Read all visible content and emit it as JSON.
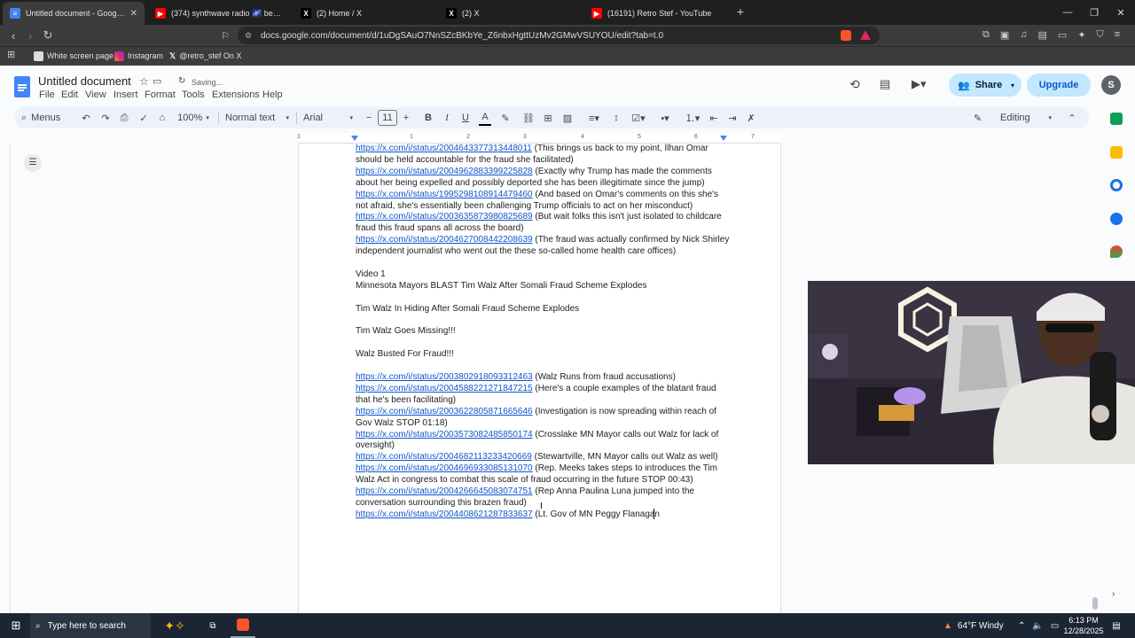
{
  "browser": {
    "tabs": [
      {
        "title": "Untitled document - Google Docs",
        "icon": "docs-icon",
        "active": true
      },
      {
        "title": "(374) synthwave radio 🌌 beats t",
        "icon": "youtube-icon",
        "active": false
      },
      {
        "title": "(2) Home / X",
        "icon": "x-icon",
        "active": false
      },
      {
        "title": "(2) X",
        "icon": "x-icon",
        "active": false
      },
      {
        "title": "(16191) Retro Stef - YouTube",
        "icon": "youtube-icon",
        "active": false
      }
    ],
    "url": "docs.google.com/document/d/1uDgSAuO7NnSZcBKbYe_Z6nbxHgttUzMv2GMwVSUYOU/edit?tab=t.0",
    "bookmarks": [
      "White screen page",
      "Instagram",
      "@retro_stef On X"
    ]
  },
  "docs": {
    "title": "Untitled document",
    "saving_status": "Saving...",
    "menu": [
      "File",
      "Edit",
      "View",
      "Insert",
      "Format",
      "Tools",
      "Extensions",
      "Help"
    ],
    "share_label": "Share",
    "upgrade_label": "Upgrade",
    "avatar_letter": "S",
    "toolbar": {
      "search": "Menus",
      "zoom": "100%",
      "style": "Normal text",
      "font": "Arial",
      "font_size": "11",
      "mode": "Editing",
      "bold": "B",
      "italic": "I",
      "underline": "U",
      "text_color": "A"
    },
    "ruler_marks": [
      "1",
      "1",
      "2",
      "3",
      "4",
      "5",
      "6",
      "7"
    ]
  },
  "document": {
    "lines": [
      {
        "link": "https://x.com/i/status/2004643377313448011",
        "text": " (This brings us back to my point, Ilhan Omar"
      },
      {
        "link": "",
        "text": "should be held accountable for the fraud she facilitated)"
      },
      {
        "link": "https://x.com/i/status/2004962883399225828",
        "text": " (Exactly why Trump has made the comments"
      },
      {
        "link": "",
        "text": "about her being expelled and possibly deported she has been illegitimate since the jump)"
      },
      {
        "link": "https://x.com/i/status/1995298108914479460",
        "text": " (And based on Omar's comments on this she's"
      },
      {
        "link": "",
        "text": "not afraid, she's essentially been challenging Trump officials to act on her misconduct)"
      },
      {
        "link": "https://x.com/i/status/2003635873980825689",
        "text": " (But wait folks this isn't just isolated to childcare"
      },
      {
        "link": "",
        "text": "fraud this fraud spans all across the board)"
      },
      {
        "link": "https://x.com/i/status/2004627008442208639",
        "text": " (The fraud was actually confirmed by Nick Shirley"
      },
      {
        "link": "",
        "text": "independent journalist who went out the these so-called home health care offices)"
      },
      {
        "link": "",
        "text": ""
      },
      {
        "link": "",
        "text": "Video 1"
      },
      {
        "link": "",
        "text": "Minnesota Mayors BLAST Tim Walz After Somali Fraud Scheme Explodes"
      },
      {
        "link": "",
        "text": ""
      },
      {
        "link": "",
        "text": "Tim Walz In Hiding After Somali Fraud Scheme Explodes"
      },
      {
        "link": "",
        "text": ""
      },
      {
        "link": "",
        "text": "Tim Walz Goes Missing!!!"
      },
      {
        "link": "",
        "text": ""
      },
      {
        "link": "",
        "text": "Walz Busted For Fraud!!!"
      },
      {
        "link": "",
        "text": ""
      },
      {
        "link": "https://x.com/i/status/2003802918093312463",
        "text": " (Walz Runs from fraud accusations)"
      },
      {
        "link": "https://x.com/i/status/2004588221271847215",
        "text": " (Here's a couple examples of the blatant fraud"
      },
      {
        "link": "",
        "text": "that he's been facilitating)"
      },
      {
        "link": "https://x.com/i/status/2003622805871665646",
        "text": " (Investigation is now spreading within reach of"
      },
      {
        "link": "",
        "text": "Gov Walz STOP 01:18)"
      },
      {
        "link": "https://x.com/i/status/2003573082485850174",
        "text": " (Crosslake MN Mayor calls out Walz for lack of"
      },
      {
        "link": "",
        "text": "oversight)"
      },
      {
        "link": "https://x.com/i/status/2004682113233420669",
        "text": " (Stewartville, MN Mayor calls out Walz as well)"
      },
      {
        "link": "https://x.com/i/status/2004696933085131070",
        "text": " (Rep. Meeks takes steps to introduces the Tim"
      },
      {
        "link": "",
        "text": "Walz Act in congress to combat this scale of fraud occurring in the future STOP 00:43)"
      },
      {
        "link": "https://x.com/i/status/2004266645083074751",
        "text": " (Rep Anna Paulina Luna jumped into the"
      },
      {
        "link": "",
        "text": "conversation surrounding this brazen fraud)"
      },
      {
        "link": "https://x.com/i/status/2004408621287833637",
        "text": " (Lt. Gov of MN Peggy Flanagan"
      }
    ]
  },
  "taskbar": {
    "search_placeholder": "Type here to search",
    "weather": "64°F  Windy",
    "time": "6:13 PM",
    "date": "12/28/2025"
  },
  "colors": {
    "accent": "#1a73e8",
    "link": "#1155cc",
    "upgrade_bg": "#c2e7ff"
  }
}
